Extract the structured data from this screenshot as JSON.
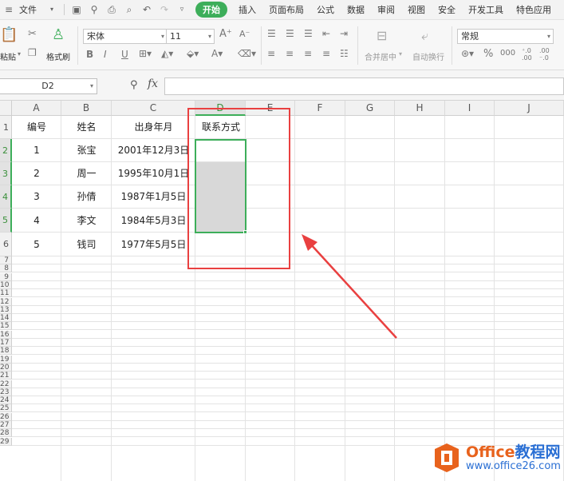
{
  "menubar": {
    "file_label": "文件",
    "tabs": [
      {
        "label": "开始",
        "active": true
      },
      {
        "label": "插入"
      },
      {
        "label": "页面布局"
      },
      {
        "label": "公式"
      },
      {
        "label": "数据"
      },
      {
        "label": "审阅"
      },
      {
        "label": "视图"
      },
      {
        "label": "安全"
      },
      {
        "label": "开发工具"
      },
      {
        "label": "特色应用"
      }
    ]
  },
  "ribbon": {
    "paste_label": "粘贴",
    "format_painter_label": "格式刷",
    "font_name": "宋体",
    "font_size": "11",
    "merge_label": "合并居中",
    "wrap_label": "自动换行",
    "number_format": "常规"
  },
  "formula_bar": {
    "cell_ref": "D2",
    "fx_label": "fx",
    "formula": ""
  },
  "sheet": {
    "columns": [
      "A",
      "B",
      "C",
      "D",
      "E",
      "F",
      "G",
      "H",
      "I",
      "J"
    ],
    "rows": [
      "1",
      "2",
      "3",
      "4",
      "5",
      "6",
      "7",
      "8",
      "9",
      "10",
      "11",
      "12",
      "13",
      "14",
      "15",
      "16",
      "17",
      "18",
      "19",
      "20",
      "21",
      "22",
      "23",
      "24",
      "25",
      "26",
      "27",
      "28",
      "29"
    ],
    "header_row": [
      "编号",
      "姓名",
      "出身年月",
      "联系方式"
    ],
    "data_rows": [
      {
        "num": "1",
        "name": "张宝",
        "dob": "2001年12月3日"
      },
      {
        "num": "2",
        "name": "周一",
        "dob": "1995年10月1日"
      },
      {
        "num": "3",
        "name": "孙倩",
        "dob": "1987年1月5日"
      },
      {
        "num": "4",
        "name": "李文",
        "dob": "1984年5月3日"
      },
      {
        "num": "5",
        "name": "钱司",
        "dob": "1977年5月5日"
      }
    ],
    "selected_range": "D2:D5"
  },
  "watermark": {
    "brand_en": "Office",
    "brand_cn": "教程网",
    "url": "www.office26.com"
  }
}
